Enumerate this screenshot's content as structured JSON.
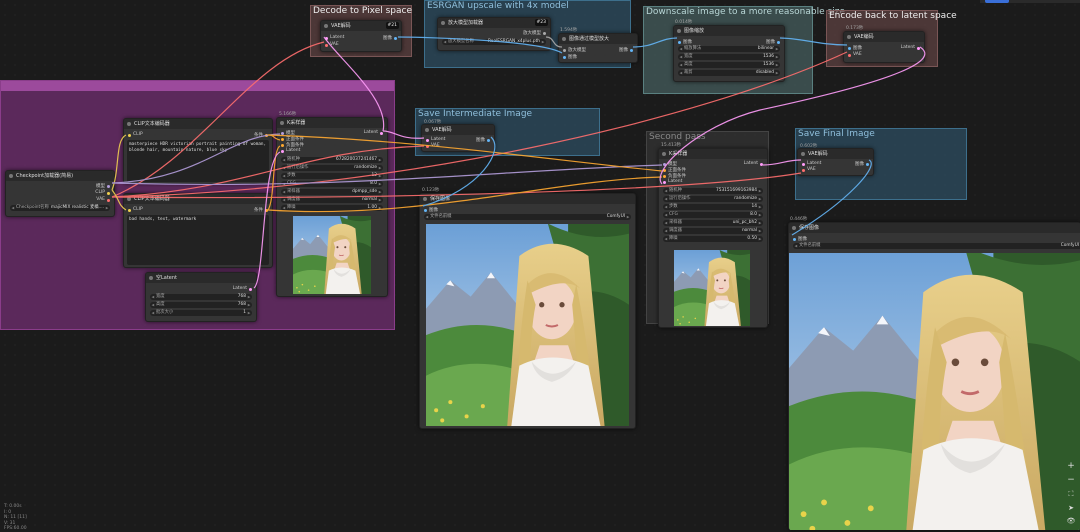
{
  "groups": {
    "decode": "Decode to Pixel space",
    "esrgan": "ESRGAN upscale with 4x model",
    "downscale": "Downscale image to a more reasonable size",
    "encode": "Encode back to latent space",
    "intermediate": "Save Intermediate Image",
    "second_pass": "Second pass",
    "final": "Save Final Image"
  },
  "nodes": {
    "vae_decode_21": {
      "id": "#21",
      "title": "VAE解码",
      "in": [
        "Latent",
        "VAE"
      ],
      "out": "图像"
    },
    "upscale_loader_23": {
      "id": "#23",
      "title": "放大模型加载器",
      "model_label": "放大模型名称",
      "model_value": "RealESRGAN_x4plus.pth"
    },
    "upscale_with_model_22": {
      "id": "#22",
      "time": "1.594秒",
      "title": "图像通过模型放大",
      "in": [
        "放大模型",
        "图像"
      ],
      "out": "图像"
    },
    "image_scale_24": {
      "id": "#24",
      "time": "0.014秒",
      "title": "图像缩放",
      "in": "图像",
      "out": "图像",
      "fields": [
        {
          "l": "缩放算法",
          "v": "bilinear"
        },
        {
          "l": "宽度",
          "v": "1536"
        },
        {
          "l": "高度",
          "v": "1536"
        },
        {
          "l": "裁剪",
          "v": "disabled"
        }
      ]
    },
    "vae_encode_20": {
      "id": "#20",
      "time": "0.173秒",
      "title": "VAE编码",
      "in": [
        "图像",
        "VAE"
      ],
      "out": "Latent"
    },
    "clip_pos_6": {
      "id": "#6",
      "title": "CLIP文本编码器",
      "in": "CLIP",
      "out": "条件",
      "text": "masterpiece HDR victorian portrait painting of woman, blonde hair, mountain nature, blue sky"
    },
    "clip_neg_7": {
      "id": "#7",
      "title": "CLIP文本编码器",
      "in": "CLIP",
      "out": "条件",
      "text": "bad hands, text, watermark"
    },
    "checkpoint_25": {
      "id": "#25",
      "title": "Checkpoint加载器(简易)",
      "outs": [
        "模型",
        "CLIP",
        "VAE"
      ],
      "field_label": "Checkpoint名称",
      "field_value": "majicMIX realistic 麦橘...."
    },
    "empty_latent_5": {
      "id": "#5",
      "title": "空Latent",
      "out": "Latent",
      "fields": [
        {
          "l": "宽度",
          "v": "768"
        },
        {
          "l": "高度",
          "v": "768"
        },
        {
          "l": "批次大小",
          "v": "1"
        }
      ]
    },
    "ksampler_3": {
      "id": "#3",
      "time": "5.166秒",
      "title": "K采样器",
      "ins": [
        "模型",
        "正面条件",
        "负面条件",
        "Latent"
      ],
      "out": "Latent",
      "fields": [
        {
          "l": "随机种",
          "v": "672820037241467"
        },
        {
          "l": "运行后操作",
          "v": "randomize"
        },
        {
          "l": "步数",
          "v": "12"
        },
        {
          "l": "CFG",
          "v": "8.0"
        },
        {
          "l": "采样器",
          "v": "dpmpp_sde"
        },
        {
          "l": "调度器",
          "v": "normal"
        },
        {
          "l": "降噪",
          "v": "1.00"
        }
      ]
    },
    "vae_decode_8": {
      "id": "#8",
      "time": "0.067秒",
      "title": "VAE解码",
      "in": [
        "Latent",
        "VAE"
      ],
      "out": "图像"
    },
    "save_9": {
      "id": "#9",
      "time": "0.123秒",
      "title": "保存图像",
      "in": "图像",
      "field_label": "文件名前缀",
      "field_value": "ComfyUI"
    },
    "ksampler_11": {
      "id": "#11",
      "time": "15.413秒",
      "title": "K采样器",
      "ins": [
        "模型",
        "正面条件",
        "负面条件",
        "Latent"
      ],
      "out": "Latent",
      "fields": [
        {
          "l": "随机种",
          "v": "753151699163984"
        },
        {
          "l": "运行后操作",
          "v": "randomize"
        },
        {
          "l": "步数",
          "v": "14"
        },
        {
          "l": "CFG",
          "v": "8.0"
        },
        {
          "l": "采样器",
          "v": "uni_pc_bh2"
        },
        {
          "l": "调度器",
          "v": "normal"
        },
        {
          "l": "降噪",
          "v": "0.50"
        }
      ]
    },
    "vae_decode_13": {
      "id": "#13",
      "time": "0.602秒",
      "title": "VAE解码",
      "in": [
        "Latent",
        "VAE"
      ],
      "out": "图像"
    },
    "save_final": {
      "time": "0.446秒",
      "title": "保存图像",
      "in": "图像",
      "field_label": "文件名前缀",
      "field_value": "ComfyUI"
    }
  },
  "stats": [
    "T: 0.00s",
    "I: 0",
    "N: 11 [11]",
    "V: 31",
    "FPS:60.00"
  ],
  "controls": [
    "+",
    "−",
    "⛶",
    "➤",
    "👁"
  ],
  "colors": {
    "clip": "#f0d050",
    "model": "#b39ddb",
    "vae": "#ff6e6e",
    "latent": "#ff9cf9",
    "image": "#64b5f6",
    "cond": "#ffa931",
    "upscale": "#aaaaaa"
  }
}
